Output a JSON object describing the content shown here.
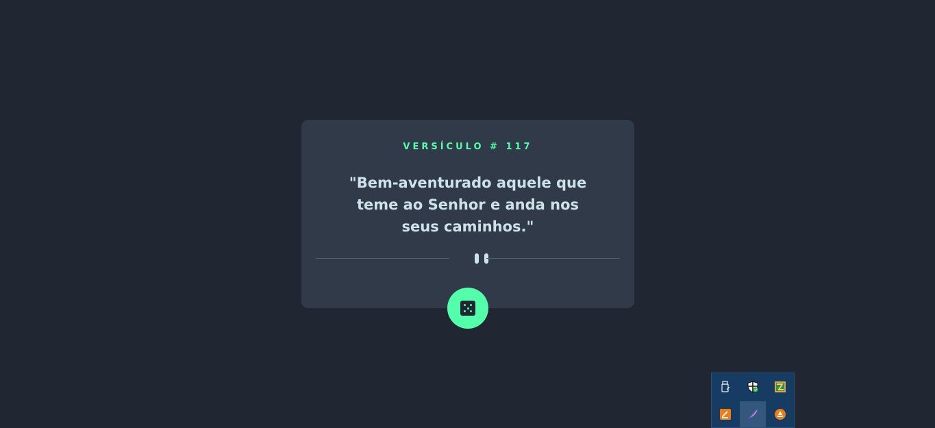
{
  "card": {
    "label": "VERSÍCULO # 117",
    "verse": "\"Bem-aventurado aquele que teme ao Senhor e anda nos seus caminhos.\""
  },
  "colors": {
    "background": "#202632",
    "card": "#313a49",
    "accent": "#53ffaa",
    "text": "#cee3e9"
  },
  "icons": {
    "divider": "pause-icon",
    "button": "dice-icon"
  },
  "tray": {
    "icons": [
      "usb-drive-icon",
      "security-shield-icon",
      "image-app-icon",
      "editor-app-icon",
      "feather-app-icon",
      "vlc-style-icon"
    ]
  }
}
